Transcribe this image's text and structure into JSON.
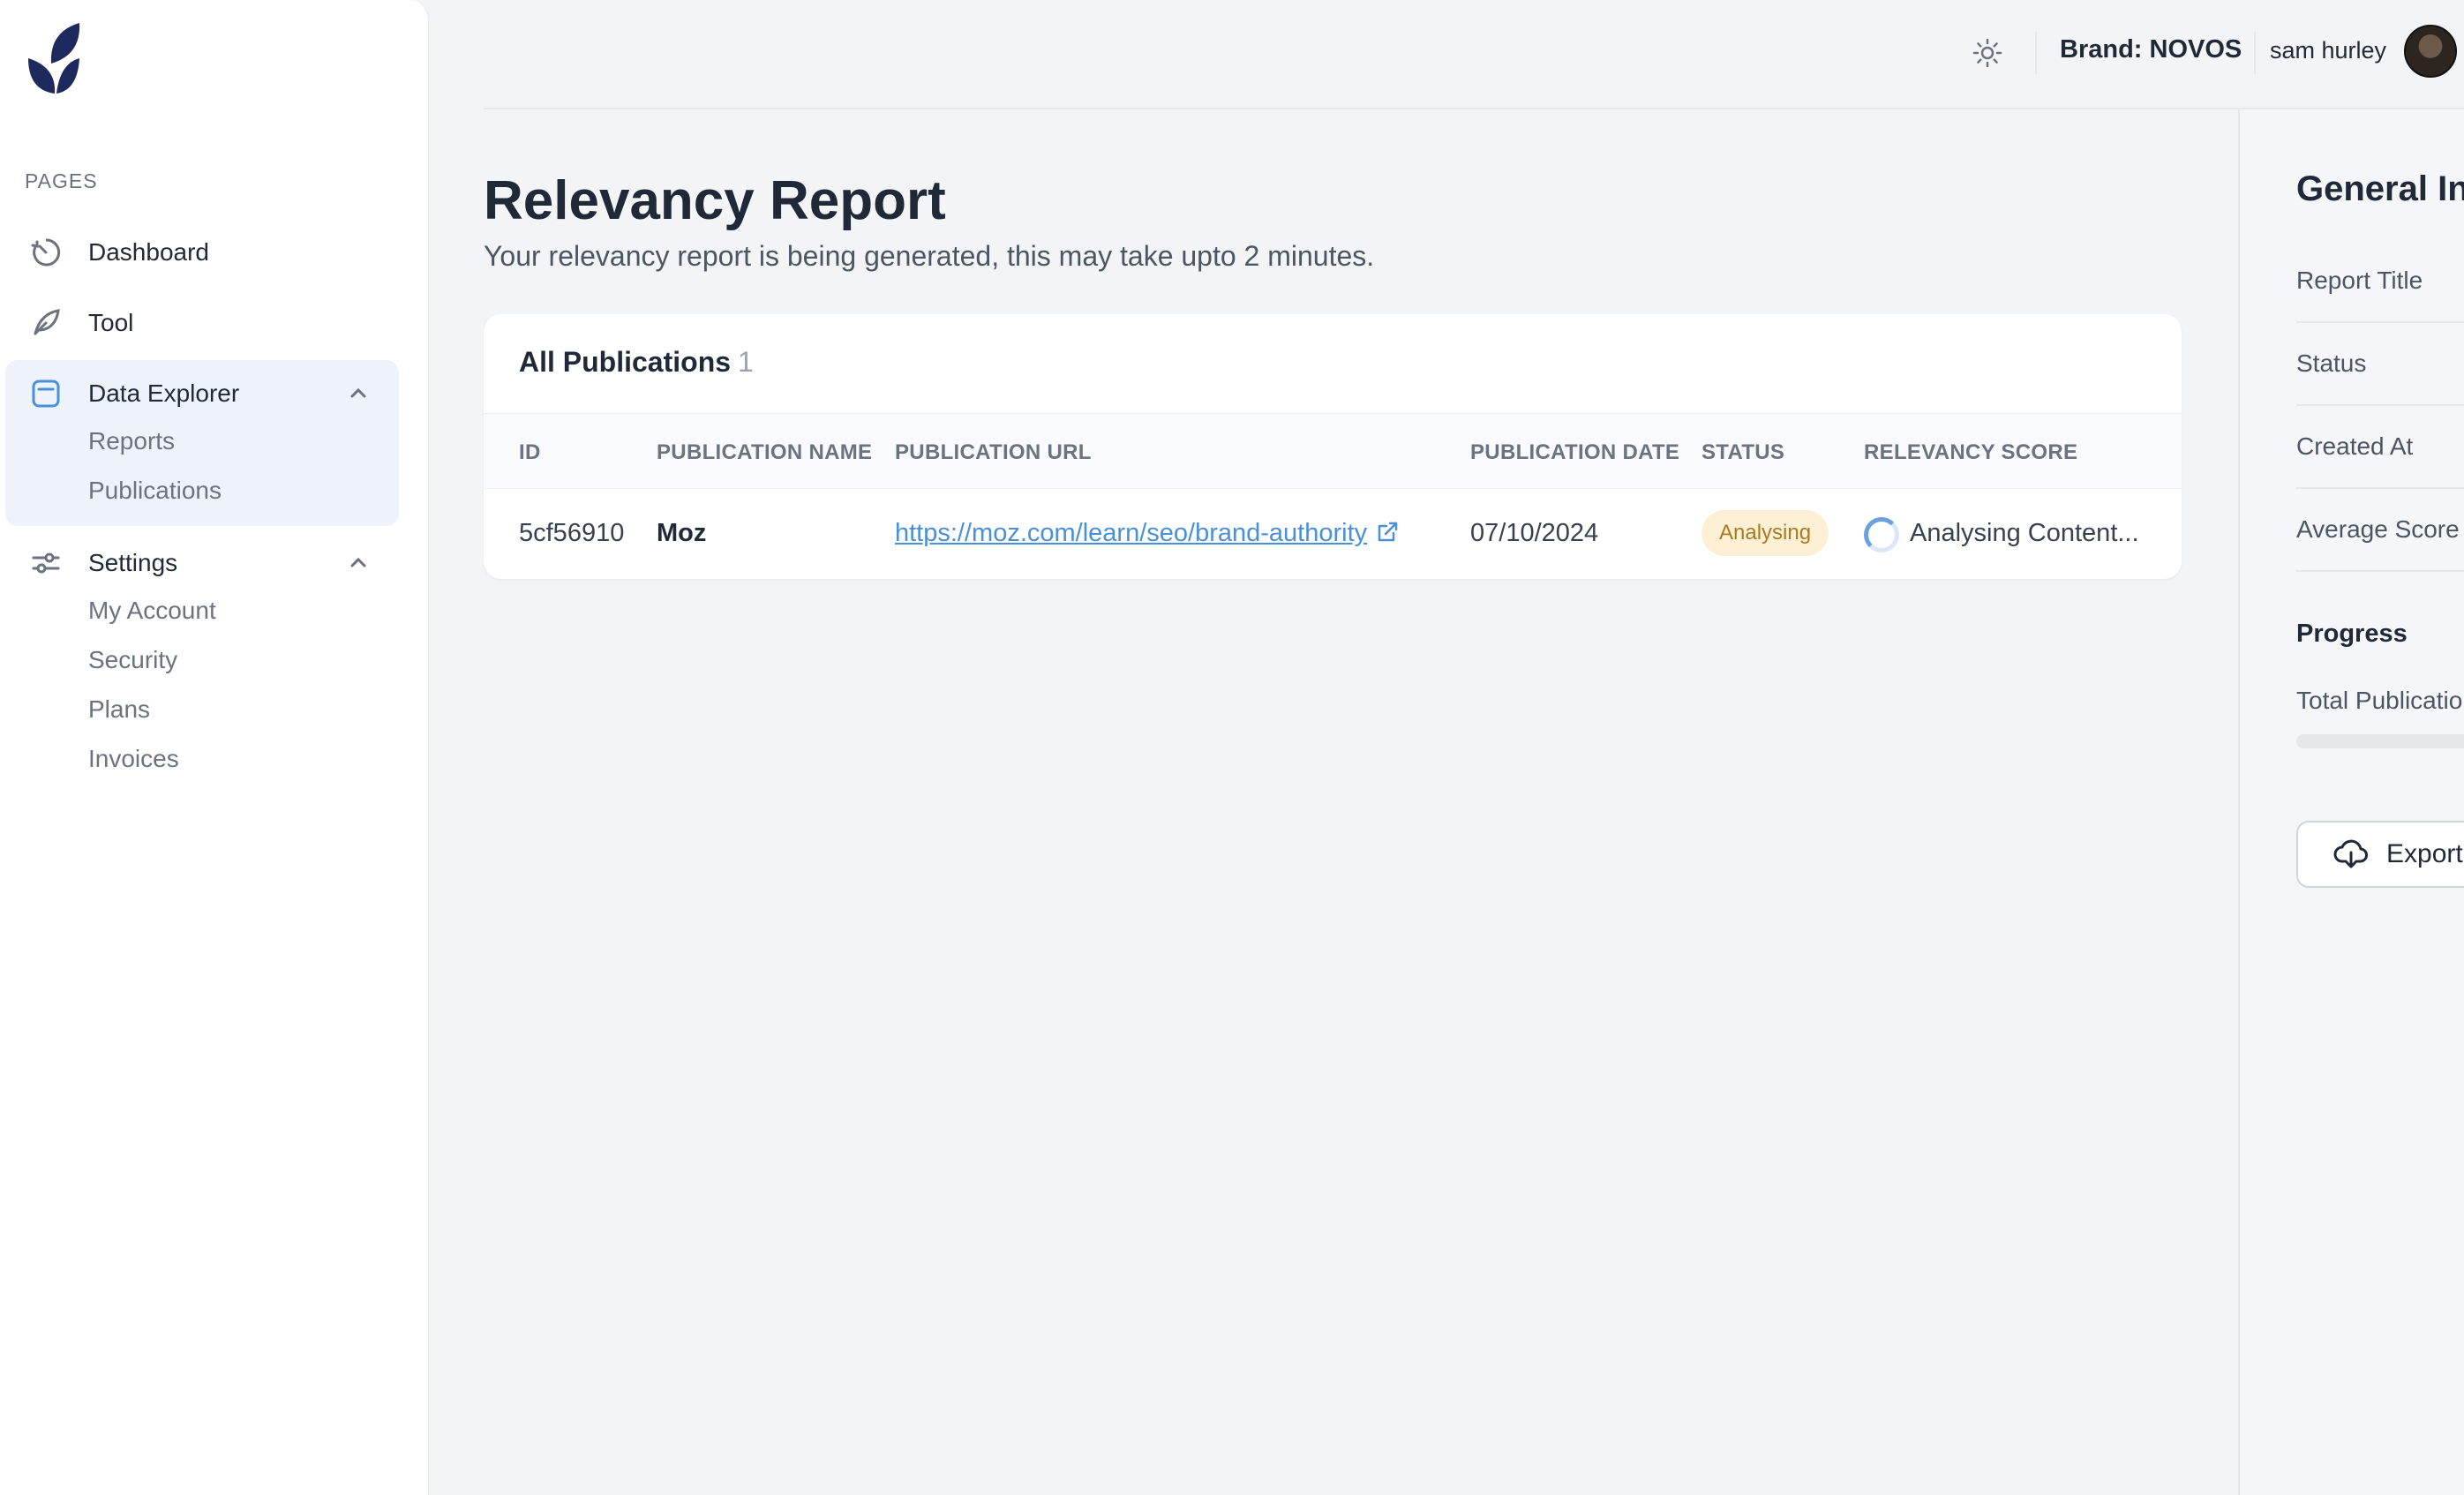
{
  "sidebar": {
    "section_label": "PAGES",
    "items": [
      {
        "label": "Dashboard",
        "icon": "gauge-icon"
      },
      {
        "label": "Tool",
        "icon": "feather-icon"
      },
      {
        "label": "Data Explorer",
        "icon": "window-icon",
        "expanded": true,
        "children": [
          {
            "label": "Reports"
          },
          {
            "label": "Publications"
          }
        ]
      },
      {
        "label": "Settings",
        "icon": "sliders-icon",
        "expanded": true,
        "children": [
          {
            "label": "My Account"
          },
          {
            "label": "Security"
          },
          {
            "label": "Plans"
          },
          {
            "label": "Invoices"
          }
        ]
      }
    ]
  },
  "header": {
    "theme_icon": "sun-icon",
    "brand": "Brand: NOVOS",
    "username": "sam hurley"
  },
  "main": {
    "title": "Relevancy Report",
    "subtitle": "Your relevancy report is being generated, this may take upto 2 minutes.",
    "table": {
      "title": "All Publications",
      "count": "1",
      "columns": [
        "ID",
        "PUBLICATION NAME",
        "PUBLICATION URL",
        "PUBLICATION DATE",
        "STATUS",
        "RELEVANCY SCORE"
      ],
      "rows": [
        {
          "id": "5cf56910",
          "name": "Moz",
          "url": "https://moz.com/learn/seo/brand-authority",
          "date": "07/10/2024",
          "status": "Analysing",
          "score": "Analysing Content..."
        }
      ]
    }
  },
  "panel": {
    "title": "General In",
    "rows": [
      "Report Title",
      "Status",
      "Created At",
      "Average Score"
    ],
    "progress_title": "Progress",
    "total_label": "Total Publicatio",
    "progress_fraction": 0.0,
    "export_label": "Export"
  },
  "colors": {
    "accent": "#4a90d9",
    "logo": "#1e2a5e",
    "badge_bg": "#fdf0d5",
    "badge_text": "#a77b22"
  }
}
